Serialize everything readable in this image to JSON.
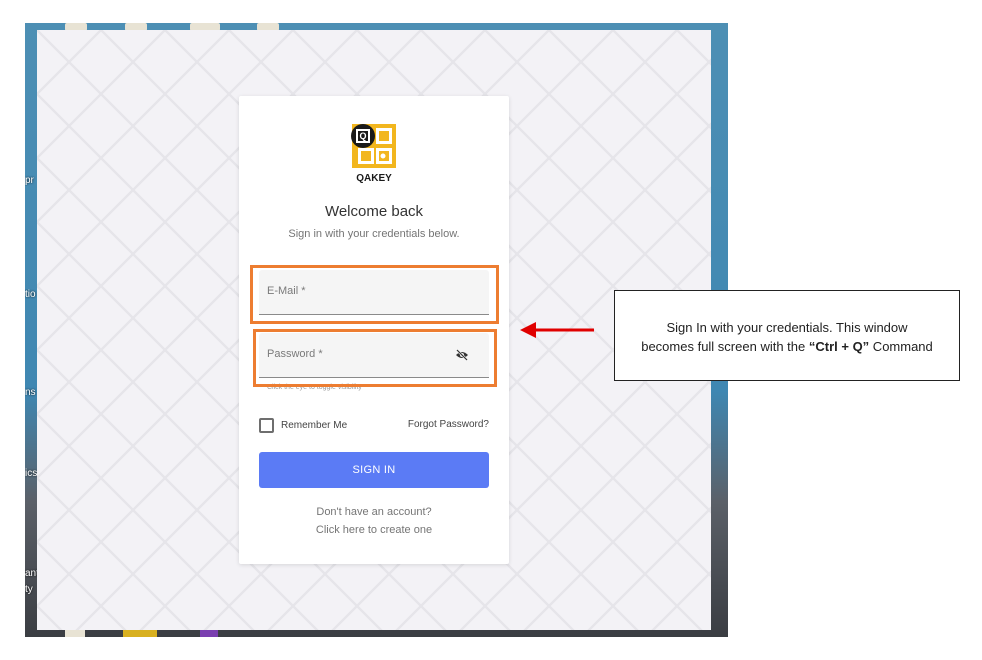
{
  "desktop": {
    "side_labels": [
      "pr",
      "tio",
      "ns",
      "ics",
      "ant",
      "ty"
    ]
  },
  "app": {
    "logo_text": "QAKEY",
    "welcome_title": "Welcome back",
    "welcome_subtitle": "Sign in with your credentials below.",
    "email_field": {
      "label": "E-Mail *",
      "value": ""
    },
    "password_field": {
      "label": "Password *",
      "value": "",
      "hint": "Click the eye to toggle visibility"
    },
    "remember_me": {
      "label": "Remember Me",
      "checked": false
    },
    "forgot_password": "Forgot Password?",
    "sign_in_button": "SIGN IN",
    "no_account": "Don't have an account?",
    "create_account": "Click here to create one",
    "accent_color": "#5b7bf5"
  },
  "annotation": {
    "highlight_color": "#ed7d31",
    "arrow_color": "#e00000",
    "callout_line1": "Sign In with your credentials. This window",
    "callout_line2_prefix": "becomes full screen with the ",
    "callout_line2_bold": "“Ctrl + Q”",
    "callout_line2_suffix": " Command"
  }
}
